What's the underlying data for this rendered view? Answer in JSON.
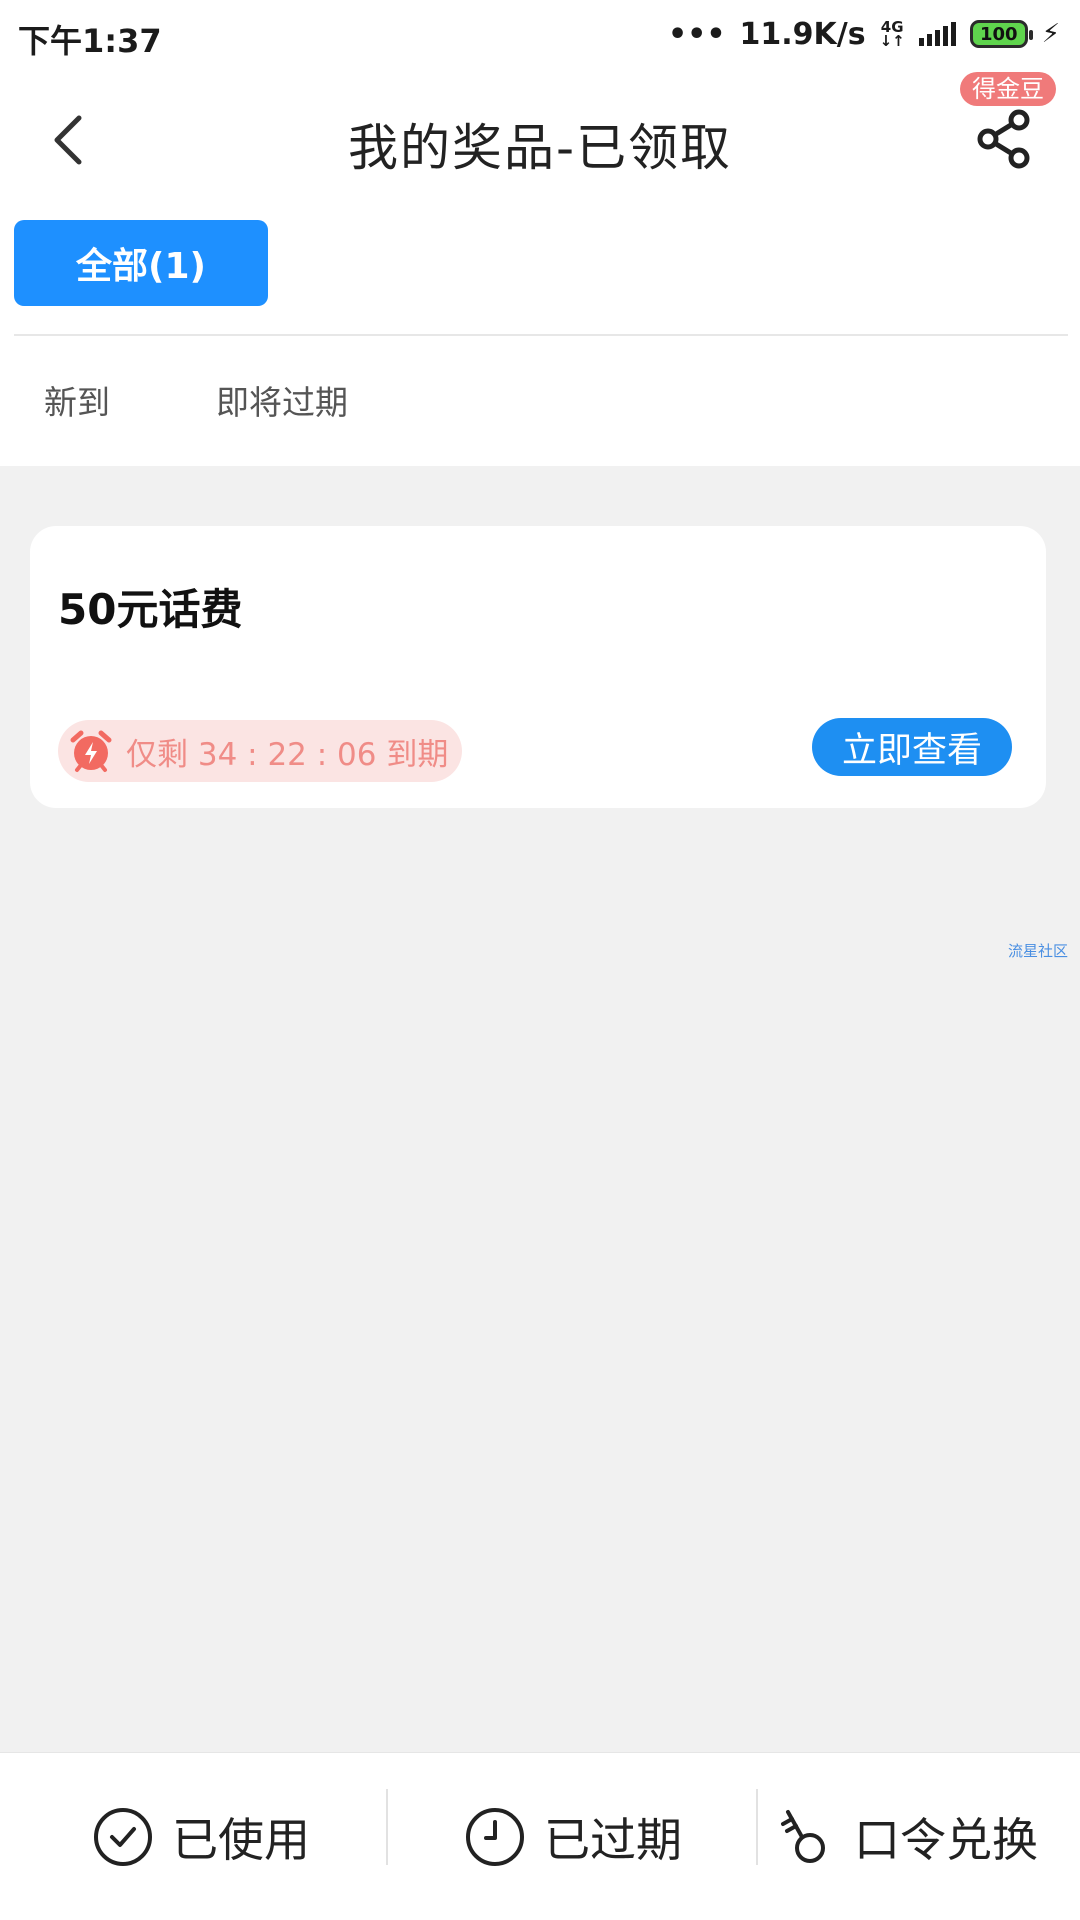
{
  "status_bar": {
    "time": "下午1:37",
    "network_speed": "11.9K/s",
    "network_type": "4G",
    "battery": "100",
    "charging_icon": "lightning-bolt-icon"
  },
  "header": {
    "back_icon": "chevron-left-icon",
    "title": "我的奖品-已领取",
    "coin_badge": "得金豆",
    "share_icon": "share-icon"
  },
  "filters": {
    "all_tab": "全部(1)",
    "sub_tabs": [
      "新到",
      "即将过期"
    ]
  },
  "prizes": [
    {
      "title": "50元话费",
      "countdown": "仅剩 34 : 22 : 06 到期",
      "alarm_icon": "alarm-clock-icon",
      "action_label": "立即查看"
    }
  ],
  "watermark": "流星社区",
  "bottom_bar": {
    "items": [
      {
        "label": "已使用",
        "icon": "check-circle-icon"
      },
      {
        "label": "已过期",
        "icon": "clock-icon"
      },
      {
        "label": "口令兑换",
        "icon": "key-icon"
      }
    ]
  },
  "colors": {
    "accent_blue": "#1e90ff",
    "countdown_bg": "#fbe4e3",
    "countdown_text": "#f08c87",
    "alarm_red": "#f26a61",
    "badge_red": "#f07a7a",
    "battery_green": "#5fd44d",
    "page_bg": "#f1f1f1"
  }
}
